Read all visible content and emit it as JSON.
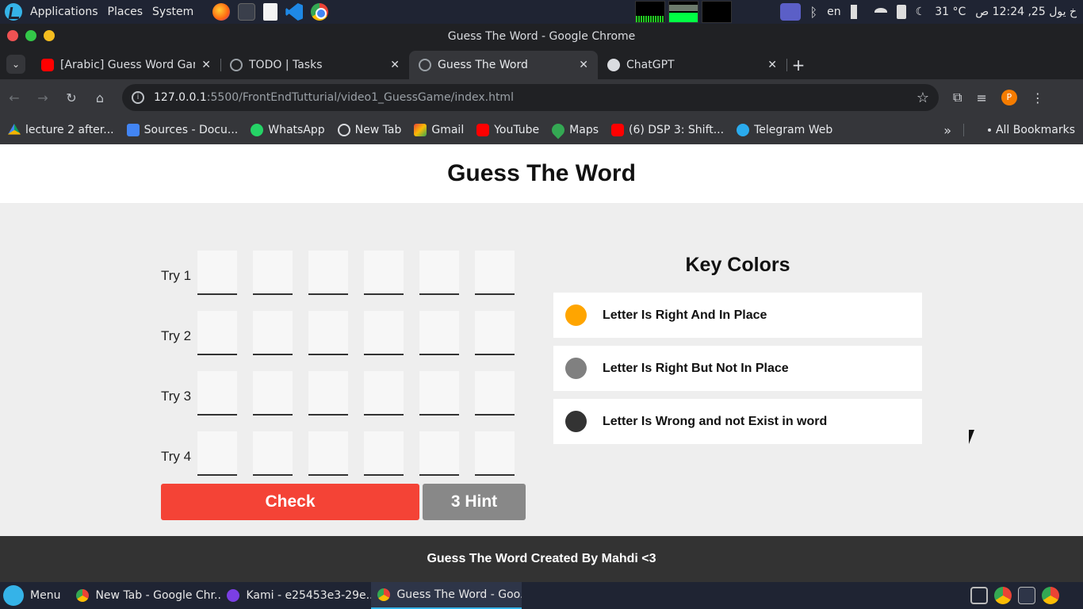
{
  "os_panel": {
    "menus": [
      "Applications",
      "Places",
      "System"
    ],
    "tray": {
      "lang": "en",
      "weather": "31 °C",
      "clock": "خ يول 25, 12:24 ص"
    }
  },
  "window": {
    "title": "Guess The Word - Google Chrome"
  },
  "tabs": [
    {
      "title": "[Arabic] Guess Word Game",
      "favicon": "youtube-icon"
    },
    {
      "title": "TODO | Tasks",
      "favicon": "globe-icon"
    },
    {
      "title": "Guess The Word",
      "favicon": "globe-icon",
      "active": true
    },
    {
      "title": "ChatGPT",
      "favicon": "chatgpt-icon"
    }
  ],
  "address_bar": {
    "host": "127.0.0.1",
    "path": ":5500/FrontEndTutturial/video1_GuessGame/index.html"
  },
  "bookmarks": [
    {
      "label": "lecture 2 after...",
      "icon": "drive"
    },
    {
      "label": "Sources - Docu...",
      "icon": "docs"
    },
    {
      "label": "WhatsApp",
      "icon": "wa"
    },
    {
      "label": "New Tab",
      "icon": "globe"
    },
    {
      "label": "Gmail",
      "icon": "gmail"
    },
    {
      "label": "YouTube",
      "icon": "yt"
    },
    {
      "label": "Maps",
      "icon": "maps"
    },
    {
      "label": "(6) DSP 3: Shift...",
      "icon": "yt"
    },
    {
      "label": "Telegram Web",
      "icon": "tg"
    }
  ],
  "bookmarks_all": "All Bookmarks",
  "page": {
    "header": "Guess The Word",
    "tries": [
      {
        "label": "Try 1",
        "letters": [
          "",
          "",
          "",
          "",
          "",
          ""
        ]
      },
      {
        "label": "Try 2",
        "letters": [
          "",
          "",
          "",
          "",
          "",
          ""
        ]
      },
      {
        "label": "Try 3",
        "letters": [
          "",
          "",
          "",
          "",
          "",
          ""
        ]
      },
      {
        "label": "Try 4",
        "letters": [
          "",
          "",
          "",
          "",
          "",
          ""
        ]
      }
    ],
    "check_label": "Check",
    "hint_label": "3 Hint",
    "key_colors": {
      "title": "Key Colors",
      "items": [
        {
          "text": "Letter Is Right And In Place",
          "color": "#ffa500"
        },
        {
          "text": "Letter Is Right But Not In Place",
          "color": "#808080"
        },
        {
          "text": "Letter Is Wrong and not Exist in word",
          "color": "#333333"
        }
      ]
    },
    "footer": "Guess The Word Created By Mahdi <3"
  },
  "taskbar": {
    "menu": "Menu",
    "tasks": [
      {
        "title": "New Tab - Google Chr...",
        "icon": "chrome"
      },
      {
        "title": "Kami - e25453e3-29e...",
        "icon": "kami"
      },
      {
        "title": "Guess The Word - Goo...",
        "icon": "chrome",
        "active": true
      }
    ]
  },
  "colors": {
    "check": "#f44336",
    "hint": "#888888",
    "footer": "#333333"
  }
}
